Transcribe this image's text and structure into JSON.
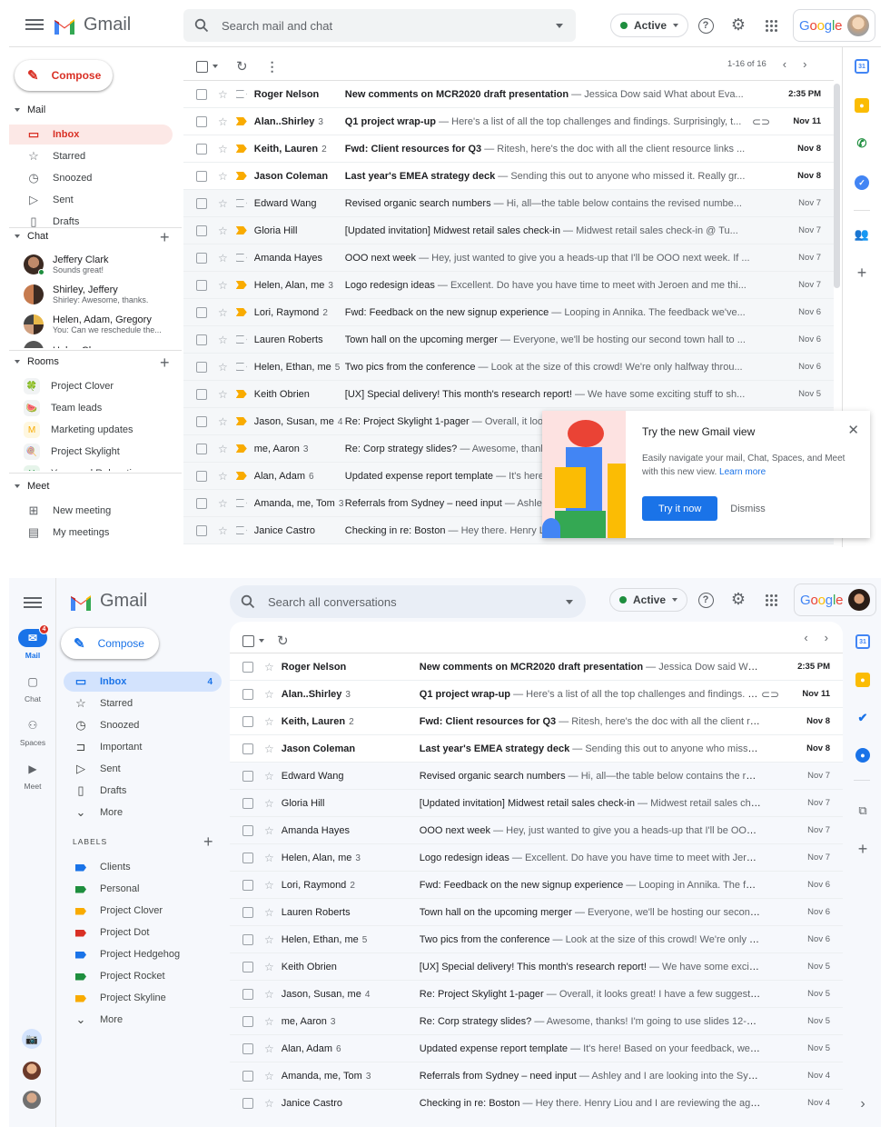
{
  "old_view": {
    "app_name": "Gmail",
    "search_placeholder": "Search mail and chat",
    "status": "Active",
    "account_brand": "Google",
    "compose_label": "Compose",
    "mail_section": "Mail",
    "nav": [
      {
        "label": "Inbox",
        "icon": "inbox-icon",
        "selected": true
      },
      {
        "label": "Starred",
        "icon": "star-icon"
      },
      {
        "label": "Snoozed",
        "icon": "clock-icon"
      },
      {
        "label": "Sent",
        "icon": "send-icon"
      },
      {
        "label": "Drafts",
        "icon": "draft-icon"
      }
    ],
    "chat_section": "Chat",
    "chats": [
      {
        "name": "Jeffery Clark",
        "snippet": "Sounds great!",
        "online": true
      },
      {
        "name": "Shirley, Jeffery",
        "snippet": "Shirley: Awesome, thanks."
      },
      {
        "name": "Helen, Adam, Gregory",
        "snippet": "You: Can we reschedule the..."
      },
      {
        "name": "Helen Chang",
        "snippet": ""
      }
    ],
    "rooms_section": "Rooms",
    "rooms": [
      {
        "name": "Project Clover",
        "icon": "🍀"
      },
      {
        "name": "Team leads",
        "icon": "🍉"
      },
      {
        "name": "Marketing updates",
        "icon": "M"
      },
      {
        "name": "Project Skylight",
        "icon": "🍭"
      },
      {
        "name": "Yoga and Relaxation",
        "icon": "Y"
      }
    ],
    "meet_section": "Meet",
    "meet": [
      {
        "label": "New meeting",
        "icon": "video-add-icon"
      },
      {
        "label": "My meetings",
        "icon": "calendar-icon"
      }
    ],
    "pagination": "1-16 of 16",
    "promo": {
      "title": "Try the new Gmail view",
      "text": "Easily navigate your mail, Chat, Spaces, and Meet with this new view.",
      "link": "Learn more",
      "primary": "Try it now",
      "secondary": "Dismiss"
    }
  },
  "new_view": {
    "app_name": "Gmail",
    "search_placeholder": "Search all conversations",
    "status": "Active",
    "account_brand": "Google",
    "compose_label": "Compose",
    "rail": [
      {
        "label": "Mail",
        "icon": "mail-icon",
        "badge": "4",
        "selected": true
      },
      {
        "label": "Chat",
        "icon": "chat-icon"
      },
      {
        "label": "Spaces",
        "icon": "spaces-icon"
      },
      {
        "label": "Meet",
        "icon": "video-icon"
      }
    ],
    "nav": [
      {
        "label": "Inbox",
        "icon": "inbox-icon",
        "count": "4",
        "selected": true
      },
      {
        "label": "Starred",
        "icon": "star-icon"
      },
      {
        "label": "Snoozed",
        "icon": "clock-icon"
      },
      {
        "label": "Important",
        "icon": "important-icon"
      },
      {
        "label": "Sent",
        "icon": "send-icon"
      },
      {
        "label": "Drafts",
        "icon": "draft-icon"
      },
      {
        "label": "More",
        "icon": "chevron-down-icon"
      }
    ],
    "labels_heading": "LABELS",
    "labels": [
      {
        "label": "Clients",
        "color": "#1a73e8"
      },
      {
        "label": "Personal",
        "color": "#1e8e3e"
      },
      {
        "label": "Project Clover",
        "color": "#f9ab00"
      },
      {
        "label": "Project Dot",
        "color": "#d93025"
      },
      {
        "label": "Project Hedgehog",
        "color": "#1a73e8"
      },
      {
        "label": "Project Rocket",
        "color": "#1e8e3e"
      },
      {
        "label": "Project Skyline",
        "color": "#f9ab00"
      },
      {
        "label": "More",
        "color": ""
      }
    ]
  },
  "emails": [
    {
      "sender": "Roger Nelson",
      "count": "",
      "subject": "New comments on MCR2020 draft presentation",
      "preview": "Jessica Dow said What about Eva...",
      "date": "2:35 PM",
      "unread": true,
      "important": false,
      "attachment": false
    },
    {
      "sender": "Alan..Shirley",
      "count": "3",
      "subject": "Q1 project wrap-up ",
      "preview": "Here's a list of all the top challenges and findings. Surprisingly, t...",
      "date": "Nov 11",
      "unread": true,
      "important": true,
      "attachment": true
    },
    {
      "sender": "Keith, Lauren",
      "count": "2",
      "subject": "Fwd: Client resources for Q3",
      "preview": "Ritesh, here's the doc with all the client resource links ...",
      "date": "Nov 8",
      "unread": true,
      "important": true,
      "attachment": false
    },
    {
      "sender": "Jason Coleman",
      "count": "",
      "subject": "Last year's EMEA strategy deck",
      "preview": "Sending this out to anyone who missed it. Really gr...",
      "date": "Nov 8",
      "unread": true,
      "important": true,
      "attachment": false
    },
    {
      "sender": "Edward Wang",
      "count": "",
      "subject": "Revised organic search numbers",
      "preview": "Hi, all—the table below contains the revised numbe...",
      "date": "Nov 7",
      "unread": false,
      "important": false,
      "attachment": false
    },
    {
      "sender": "Gloria Hill",
      "count": "",
      "subject": "[Updated invitation] Midwest retail sales check-in",
      "preview": "Midwest retail sales check-in @ Tu...",
      "date": "Nov 7",
      "unread": false,
      "important": true,
      "attachment": false
    },
    {
      "sender": "Amanda Hayes",
      "count": "",
      "subject": "OOO next week",
      "preview": "Hey, just wanted to give you a heads-up that I'll be OOO next week. If ...",
      "date": "Nov 7",
      "unread": false,
      "important": false,
      "attachment": false
    },
    {
      "sender": "Helen, Alan, me",
      "count": "3",
      "subject": "Logo redesign ideas",
      "preview": "Excellent. Do have you have time to meet with Jeroen and me thi...",
      "date": "Nov 7",
      "unread": false,
      "important": true,
      "attachment": false
    },
    {
      "sender": "Lori, Raymond",
      "count": "2",
      "subject": "Fwd: Feedback on the new signup experience",
      "preview": "Looping in Annika. The feedback we've...",
      "date": "Nov 6",
      "unread": false,
      "important": true,
      "attachment": false
    },
    {
      "sender": "Lauren Roberts",
      "count": "",
      "subject": "Town hall on the upcoming merger",
      "preview": "Everyone, we'll be hosting our second town hall to ...",
      "date": "Nov 6",
      "unread": false,
      "important": false,
      "attachment": false
    },
    {
      "sender": "Helen, Ethan, me",
      "count": "5",
      "subject": "Two pics from the conference",
      "preview": "Look at the size of this crowd! We're only halfway throu...",
      "date": "Nov 6",
      "unread": false,
      "important": false,
      "attachment": false
    },
    {
      "sender": "Keith Obrien",
      "count": "",
      "subject": "[UX] Special delivery! This month's research report!",
      "preview": "We have some exciting stuff to sh...",
      "date": "Nov 5",
      "unread": false,
      "important": true,
      "attachment": false
    },
    {
      "sender": "Jason, Susan, me",
      "count": "4",
      "subject": "Re: Project Skylight 1-pager",
      "preview": "Overall, it looks great! I have a few suggestions for what t...",
      "date": "Nov 5",
      "unread": false,
      "important": true,
      "attachment": false
    },
    {
      "sender": "me, Aaron",
      "count": "3",
      "subject": "Re: Corp strategy slides?",
      "preview": "Awesome, thanks! I'm going to use slides 12-27 in my presen...",
      "date": "Nov 5",
      "unread": false,
      "important": true,
      "attachment": false
    },
    {
      "sender": "Alan, Adam",
      "count": "6",
      "subject": "Updated expense report template",
      "preview": "It's here! Based on your feedback, we've (hopefully)...",
      "date": "Nov 5",
      "unread": false,
      "important": true,
      "attachment": false
    },
    {
      "sender": "Amanda, me, Tom",
      "count": "3",
      "subject": "Referrals from Sydney – need input",
      "preview": "Ashley and I are looking into the Sydney market, a...",
      "date": "Nov 4",
      "unread": false,
      "important": false,
      "attachment": false
    },
    {
      "sender": "Janice Castro",
      "count": "",
      "subject": "Checking in re: Boston",
      "preview": "Hey there. Henry Liou and I are reviewing the agenda for Boston...",
      "date": "Nov 4",
      "unread": false,
      "important": false,
      "attachment": false
    }
  ],
  "colors": {
    "accent_red": "#d93025",
    "accent_blue": "#1a73e8",
    "important": "#f9ab00",
    "online": "#1e8e3e"
  }
}
